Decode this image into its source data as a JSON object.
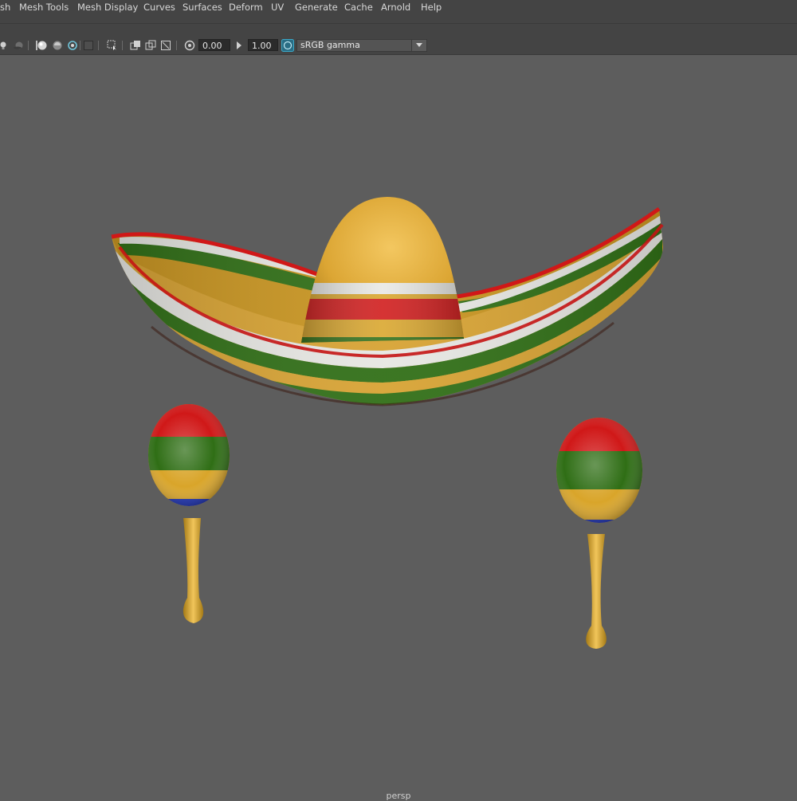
{
  "menubar": {
    "items": [
      "sh",
      "Mesh Tools",
      "Mesh Display",
      "Curves",
      "Surfaces",
      "Deform",
      "UV",
      "Generate",
      "Cache",
      "Arnold",
      "Help"
    ]
  },
  "toolbar": {
    "exposure_value": "0.00",
    "gamma_value": "1.00",
    "colorspace": "sRGB gamma",
    "icons": [
      "light-icon",
      "shadow-icon",
      "ao-icon",
      "wireframe-shaded-icon",
      "xray-icon",
      "isolate-icon",
      "select-camera-icon",
      "bookmark-icon",
      "image-plane-icon",
      "grid-icon",
      "resolution-gate-icon",
      "exposure-icon",
      "gamma-icon",
      "color-management-icon"
    ]
  },
  "viewport": {
    "camera_label": "persp",
    "objects": [
      "sombrero",
      "maraca-left",
      "maraca-right"
    ],
    "colors": {
      "background": "#5d5d5d",
      "red": "#d01818",
      "green": "#2e6e14",
      "yellow": "#d9a52a",
      "white": "#e8e8e4",
      "blue": "#1a2fb0"
    }
  }
}
